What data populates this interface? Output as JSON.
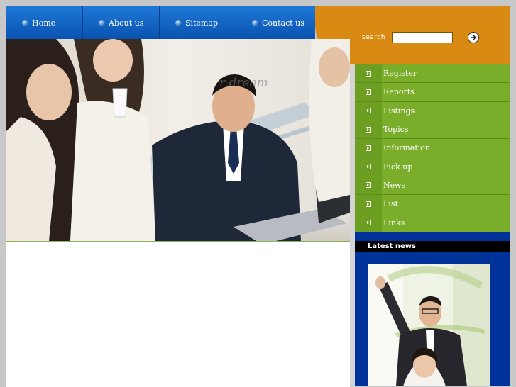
{
  "nav": {
    "items": [
      {
        "label": "Home"
      },
      {
        "label": "About us"
      },
      {
        "label": "Sitemap"
      },
      {
        "label": "Contact us"
      }
    ]
  },
  "search": {
    "label": "search",
    "value": "",
    "placeholder": ""
  },
  "hero": {
    "caption": "r dream"
  },
  "menu": {
    "items": [
      {
        "label": "Register"
      },
      {
        "label": "Reports"
      },
      {
        "label": "Listings"
      },
      {
        "label": "Topics"
      },
      {
        "label": "Information"
      },
      {
        "label": "Pick up"
      },
      {
        "label": "News"
      },
      {
        "label": "List"
      },
      {
        "label": "Links"
      }
    ]
  },
  "news": {
    "header": "Latest news"
  },
  "colors": {
    "nav_blue": "#0a52b0",
    "search_orange": "#d98a12",
    "menu_green": "#7aae2a",
    "news_blue": "#003399"
  }
}
